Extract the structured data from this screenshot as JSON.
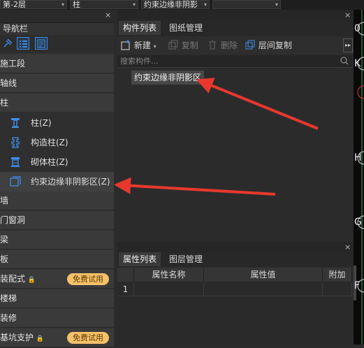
{
  "topbar": {
    "floor": "第-2层",
    "type": "柱",
    "subtype": "约束边缘非阴影",
    "extra": ""
  },
  "nav": {
    "title": "导航栏",
    "close": "×",
    "sections": [
      {
        "label": "施工段"
      },
      {
        "label": "轴线"
      },
      {
        "label": "柱"
      },
      {
        "label": "墙"
      },
      {
        "label": "门窗洞"
      },
      {
        "label": "梁"
      },
      {
        "label": "板"
      },
      {
        "label": "装配式",
        "badge": "免费试用"
      },
      {
        "label": "楼梯"
      },
      {
        "label": "装修"
      },
      {
        "label": "基坑支护",
        "badge": "免费试用"
      }
    ],
    "column_items": [
      {
        "label": "柱(Z)",
        "icon": "column-icon"
      },
      {
        "label": "构造柱(Z)",
        "icon": "structural-column-icon"
      },
      {
        "label": "砌体柱(Z)",
        "icon": "masonry-column-icon"
      },
      {
        "label": "约束边缘非阴影区(Z)",
        "icon": "edge-zone-icon"
      }
    ]
  },
  "components": {
    "tabs": [
      "构件列表",
      "图纸管理"
    ],
    "new": "新建",
    "copy": "复制",
    "delete": "删除",
    "floor_copy": "层间复制",
    "search_placeholder": "搜索构件...",
    "items": [
      "约束边缘非阴影区"
    ],
    "close": "×"
  },
  "properties": {
    "tabs": [
      "属性列表",
      "图层管理"
    ],
    "columns": [
      "属性名称",
      "属性值",
      "附加"
    ],
    "rows": [
      {
        "index": "1",
        "name": "",
        "value": "",
        "extra": ""
      }
    ],
    "close": "×"
  },
  "canvas": {
    "axis_labels": [
      "0",
      "K",
      "H",
      "G",
      "F"
    ]
  },
  "colors": {
    "accent": "#3c8de8",
    "badge": "#f6c16a",
    "arrow": "#e8382e"
  }
}
